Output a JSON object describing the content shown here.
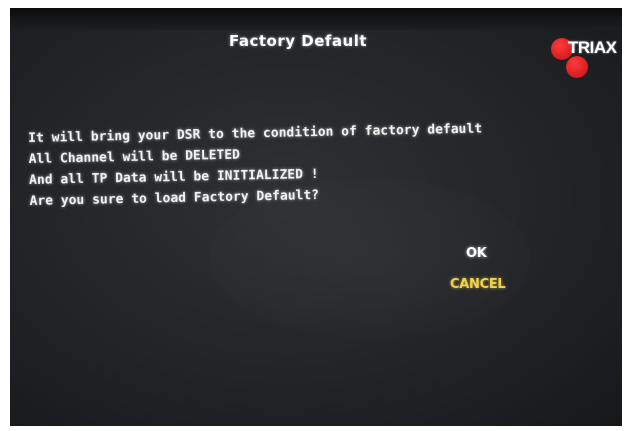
{
  "dialog": {
    "title": "Factory Default",
    "message_lines": [
      "It will bring your DSR to the condition of factory default",
      "All Channel will be DELETED",
      "And all TP Data will be INITIALIZED !",
      "Are you sure to load Factory Default?"
    ],
    "ok_label": "OK",
    "cancel_label": "CANCEL",
    "selected_button": "CANCEL"
  },
  "brand": {
    "logo_text": "TRIAX",
    "logo_color": "#d8141a"
  },
  "colors": {
    "screen_background": "#26282b",
    "text": "#f2f2f2",
    "highlight": "#f0d34a"
  }
}
